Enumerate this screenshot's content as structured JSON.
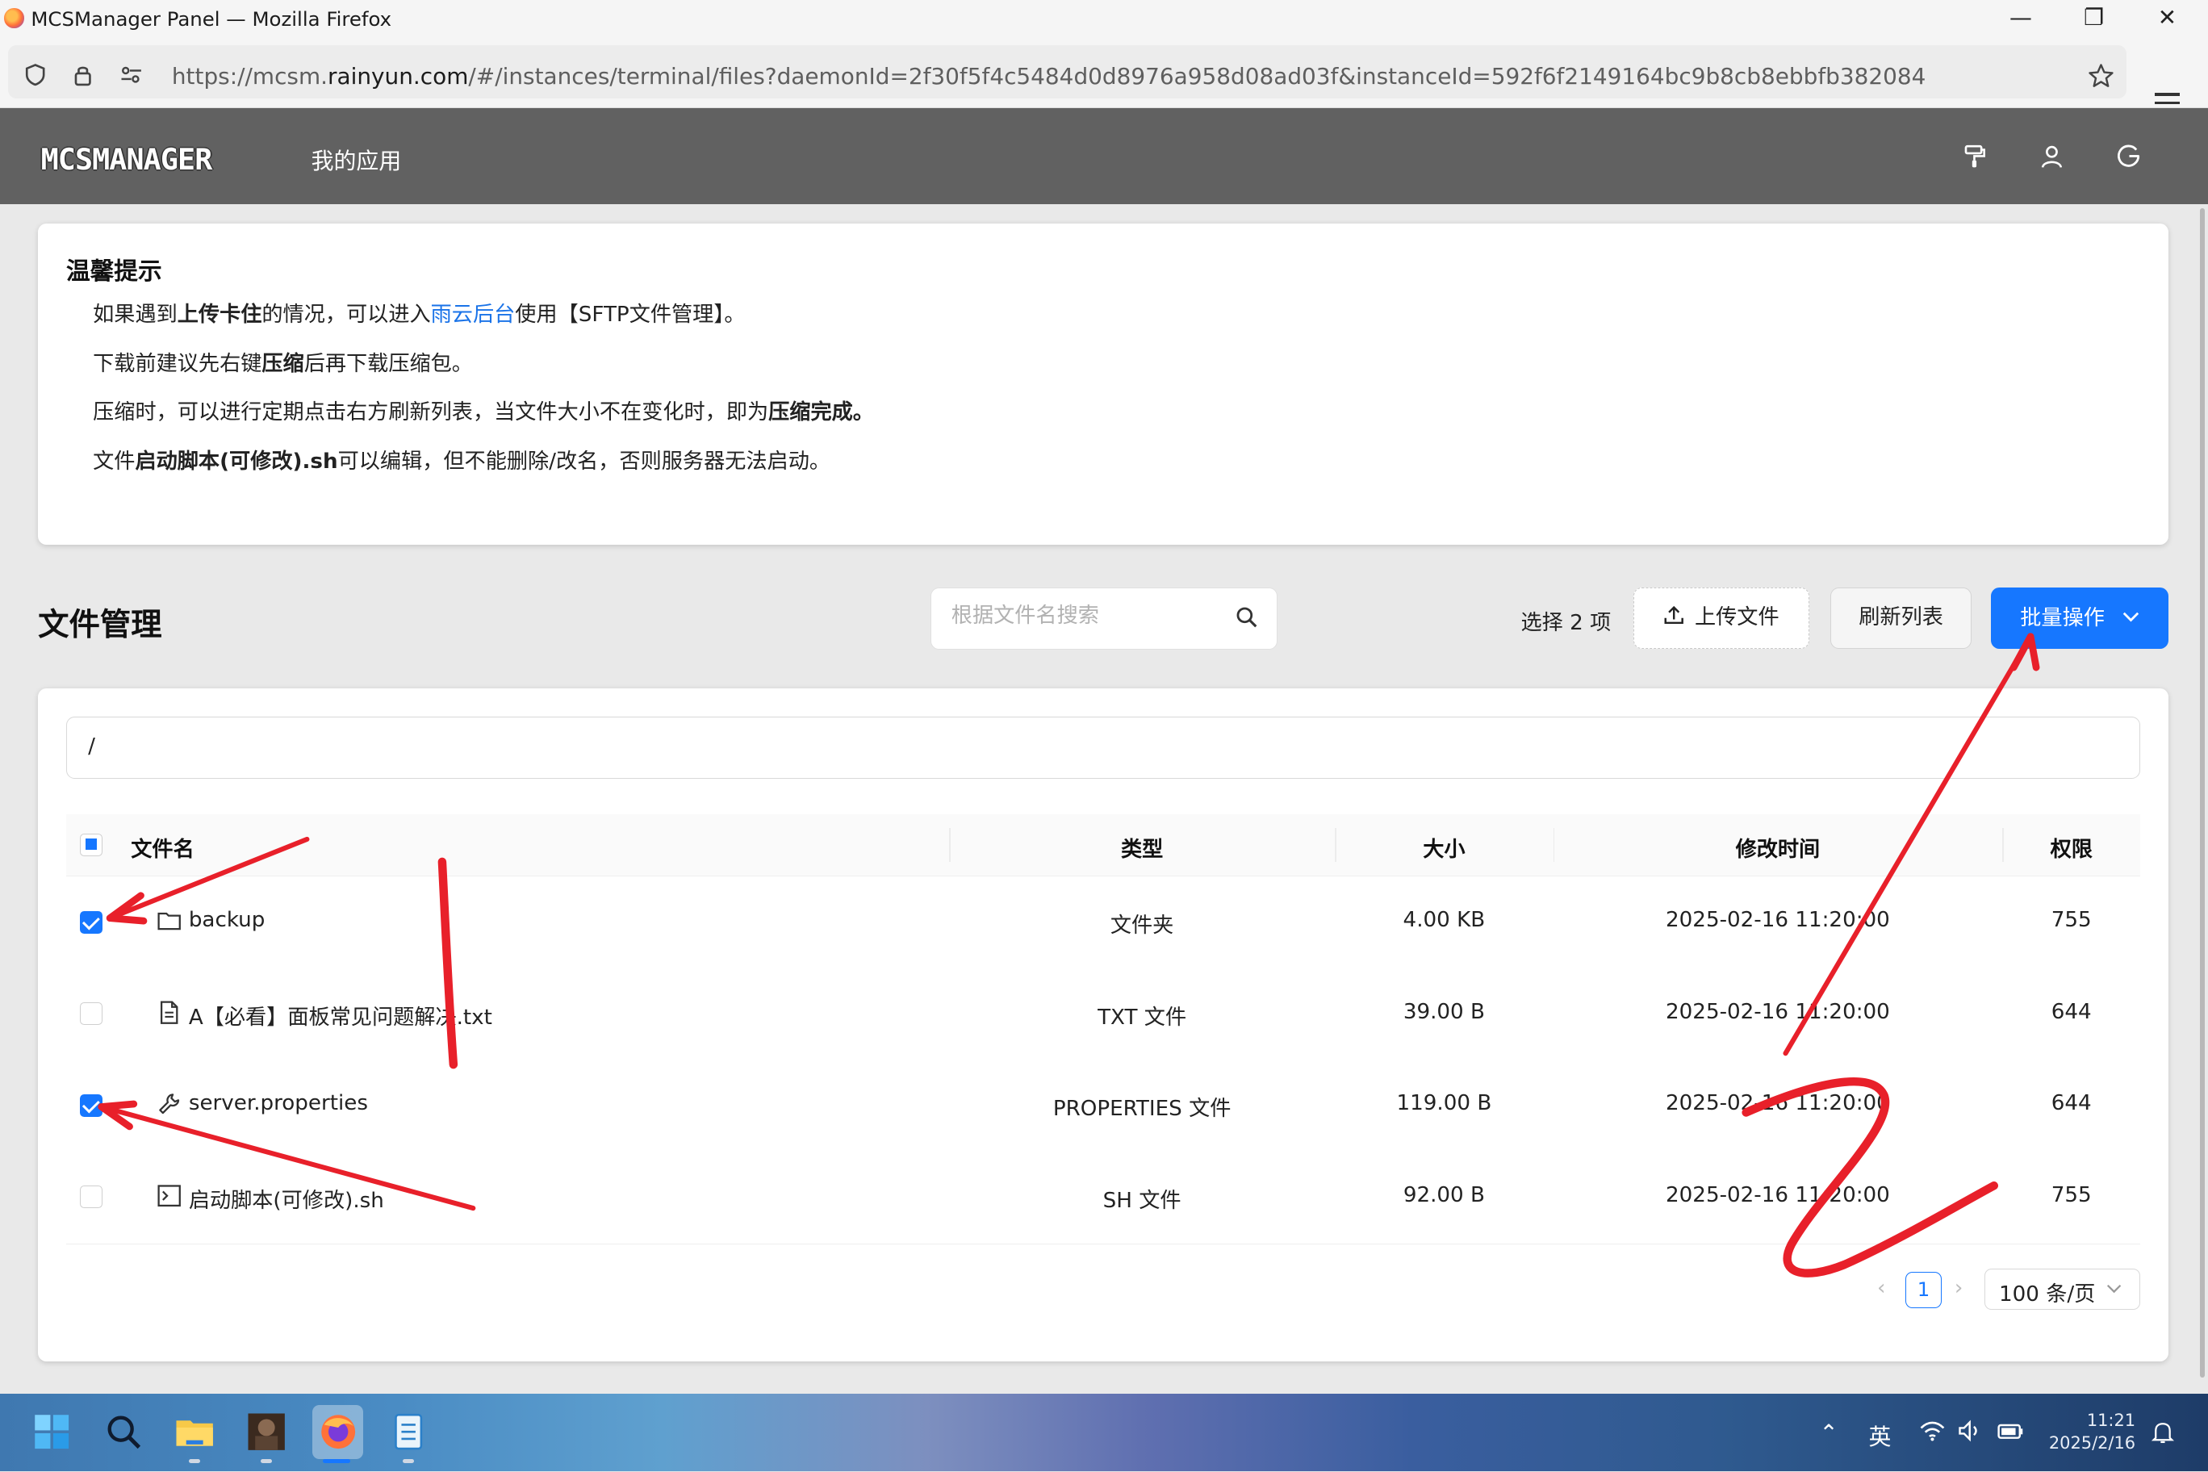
{
  "browser": {
    "window_title": "MCSManager Panel — Mozilla Firefox",
    "url_prefix": "https://mcsm.",
    "url_domain": "rainyun.com",
    "url_rest": "/#/instances/terminal/files?daemonId=2f30f5f4c5484d0d8976a958d08ad03f&instanceId=592f6f2149164bc9b8cb8ebbfb382084",
    "icons": [
      "firefox-icon",
      "shield-icon",
      "lock-icon",
      "permissions-icon",
      "bookmark-star-icon",
      "menu-icon"
    ]
  },
  "app": {
    "logo": "MCSMANAGER",
    "nav_label": "我的应用",
    "header_icons": [
      "theme-brush-icon",
      "user-icon",
      "logout-icon"
    ]
  },
  "notice": {
    "title": "温馨提示",
    "line1": {
      "a": "如果遇到",
      "b": "上传卡住",
      "c": "的情况，可以进入",
      "link": "雨云后台",
      "d": "使用【SFTP文件管理】。"
    },
    "line2": {
      "a": "下载前建议先右键",
      "b": "压缩",
      "c": "后再下载压缩包。"
    },
    "line3": {
      "a": "压缩时，可以进行定期点击右方刷新列表，当文件大小不在变化时，即为",
      "b": "压缩完成。"
    },
    "line4": {
      "a": "文件",
      "b": "启动脚本(可修改).sh",
      "c": "可以编辑，但不能删除/改名，否则服务器无法启动。"
    }
  },
  "files": {
    "section_title": "文件管理",
    "search_placeholder": "根据文件名搜索",
    "selected_text": "选择 2 项",
    "upload_label": "上传文件",
    "refresh_label": "刷新列表",
    "batch_label": "批量操作",
    "path": "/",
    "columns": [
      "文件名",
      "类型",
      "大小",
      "修改时间",
      "权限"
    ],
    "select_all_state": "indeterminate",
    "rows": [
      {
        "name": "backup",
        "type": "文件夹",
        "size": "4.00 KB",
        "modified": "2025-02-16 11:20:00",
        "perm": "755",
        "checked": true,
        "icon": "folder-icon"
      },
      {
        "name": "A【必看】面板常见问题解决.txt",
        "type": "TXT 文件",
        "size": "39.00 B",
        "modified": "2025-02-16 11:20:00",
        "perm": "644",
        "checked": false,
        "icon": "text-file-icon"
      },
      {
        "name": "server.properties",
        "type": "PROPERTIES 文件",
        "size": "119.00 B",
        "modified": "2025-02-16 11:20:00",
        "perm": "644",
        "checked": true,
        "icon": "wrench-icon"
      },
      {
        "name": "启动脚本(可修改).sh",
        "type": "SH 文件",
        "size": "92.00 B",
        "modified": "2025-02-16 11:20:00",
        "perm": "755",
        "checked": false,
        "icon": "terminal-icon"
      }
    ],
    "pagination": {
      "current": "1",
      "page_size": "100 条/页"
    }
  },
  "annotation": {
    "text": "2",
    "color": "#e8202a"
  },
  "taskbar": {
    "apps": [
      "windows-start-icon",
      "search-icon",
      "file-explorer-icon",
      "photo-app-icon",
      "firefox-icon",
      "notepad-icon"
    ],
    "lang": "英",
    "time": "11:21",
    "date": "2025/2/16"
  },
  "colors": {
    "accent": "#1677ff",
    "header": "#616161",
    "link": "#1a73e8"
  }
}
